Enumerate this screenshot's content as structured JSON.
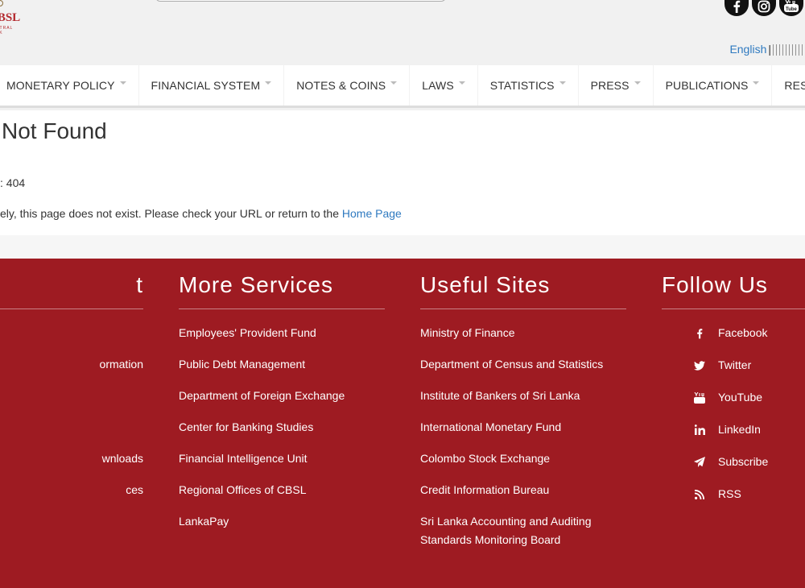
{
  "header": {
    "logo_text": "CBSL",
    "logo_tagline": "CENTRAL BANK",
    "lang_english": "English",
    "lang_separator": "|"
  },
  "social_icons": [
    "facebook-icon",
    "instagram-icon",
    "youtube-icon"
  ],
  "nav": {
    "items": [
      "MONETARY POLICY",
      "FINANCIAL SYSTEM",
      "NOTES & COINS",
      "LAWS",
      "STATISTICS",
      "PRESS",
      "PUBLICATIONS",
      "RESE"
    ]
  },
  "content": {
    "title": "Not Found",
    "code_text": ": 404",
    "message_text": "ely, this page does not exist. Please check your URL or return to the ",
    "home_link": "Home Page"
  },
  "footer": {
    "col1": {
      "title": "t",
      "items": [
        "",
        "ormation",
        "",
        "",
        "wnloads",
        "ces"
      ]
    },
    "col2": {
      "title": "More Services",
      "items": [
        "Employees' Provident Fund",
        "Public Debt Management",
        "Department of Foreign Exchange",
        "Center for Banking Studies",
        "Financial Intelligence Unit",
        "Regional Offices of CBSL",
        "LankaPay"
      ]
    },
    "col3": {
      "title": "Useful Sites",
      "items": [
        "Ministry of Finance",
        "Department of Census and Statistics",
        "Institute of Bankers of Sri Lanka",
        "International Monetary Fund",
        "Colombo Stock Exchange",
        "Credit Information Bureau",
        "Sri Lanka Accounting and Auditing Standards Monitoring Board"
      ]
    },
    "col4": {
      "title": "Follow Us",
      "items": [
        {
          "label": "Facebook",
          "icon": "facebook-icon"
        },
        {
          "label": "Twitter",
          "icon": "twitter-icon"
        },
        {
          "label": "YouTube",
          "icon": "youtube-icon"
        },
        {
          "label": "LinkedIn",
          "icon": "linkedin-icon"
        },
        {
          "label": "Subscribe",
          "icon": "send-icon"
        },
        {
          "label": "RSS",
          "icon": "rss-icon"
        }
      ]
    }
  },
  "colors": {
    "footer_bg": "#9e1b22",
    "link": "#2f7ac0",
    "brand_red": "#b3282d"
  }
}
